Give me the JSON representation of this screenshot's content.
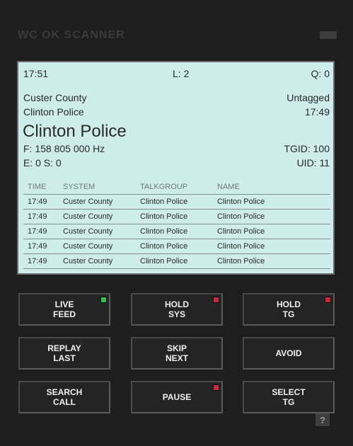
{
  "app": {
    "title": "WC OK SCANNER"
  },
  "display": {
    "time": "17:51",
    "level": "L: 2",
    "queue": "Q: 0",
    "system": "Custer County",
    "tag": "Untagged",
    "talkgroup": "Clinton Police",
    "last_time": "17:49",
    "main_label": "Clinton Police",
    "frequency": "F: 158 805 000 Hz",
    "tgid": "TGID: 100",
    "errors": "E: 0 S: 0",
    "uid": "UID: 11"
  },
  "history": {
    "columns": [
      "TIME",
      "SYSTEM",
      "TALKGROUP",
      "NAME"
    ],
    "rows": [
      [
        "17:49",
        "Custer County",
        "Clinton Police",
        "Clinton Police"
      ],
      [
        "17:49",
        "Custer County",
        "Clinton Police",
        "Clinton Police"
      ],
      [
        "17:49",
        "Custer County",
        "Clinton Police",
        "Clinton Police"
      ],
      [
        "17:49",
        "Custer County",
        "Clinton Police",
        "Clinton Police"
      ],
      [
        "17:49",
        "Custer County",
        "Clinton Police",
        "Clinton Police"
      ]
    ]
  },
  "buttons": {
    "live_feed": "LIVE\nFEED",
    "hold_sys": "HOLD\nSYS",
    "hold_tg": "HOLD\nTG",
    "replay_last": "REPLAY\nLAST",
    "skip_next": "SKIP\nNEXT",
    "avoid": "AVOID",
    "search_call": "SEARCH\nCALL",
    "pause": "PAUSE",
    "select_tg": "SELECT\nTG"
  },
  "leds": {
    "live_feed": "#2ec24a",
    "hold_sys": "#c8283c",
    "hold_tg": "#c8283c",
    "pause": "#c8283c"
  },
  "help": {
    "label": "?"
  },
  "icons": {
    "window": "minimize-icon",
    "help": "help-icon"
  }
}
